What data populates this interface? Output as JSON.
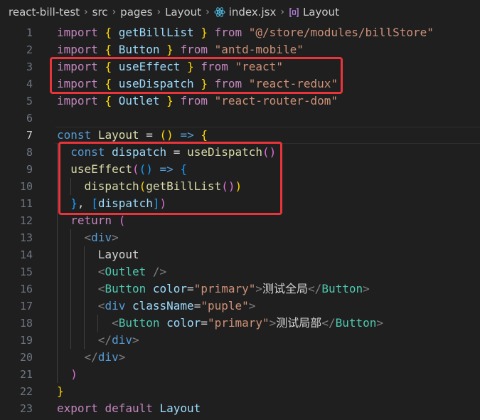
{
  "breadcrumb": {
    "project": "react-bill-test",
    "folder1": "src",
    "folder2": "pages",
    "folder3": "Layout",
    "file": "index.jsx",
    "symbol": "Layout",
    "file_icon": "react-icon",
    "symbol_icon": "symbol-method-icon"
  },
  "colors": {
    "background": "#1f1f1f",
    "keyword": "#569cd6",
    "control_keyword": "#c586c0",
    "function": "#dcdcaa",
    "variable": "#9cdcfe",
    "string": "#ce9178",
    "component": "#4ec9b0",
    "highlight_box": "#e8343a"
  },
  "editor": {
    "active_line": 7,
    "highlighted_ranges": [
      "3-4",
      "8-11"
    ],
    "lines": [
      {
        "n": "1",
        "t": {
          "k1": "import",
          "b1": "{",
          "id": "getBillList",
          "b2": "}",
          "from": "from",
          "s": "\"@/store/modules/billStore\""
        }
      },
      {
        "n": "2",
        "t": {
          "k1": "import",
          "b1": "{",
          "id": "Button",
          "b2": "}",
          "from": "from",
          "s": "\"antd-mobile\""
        }
      },
      {
        "n": "3",
        "t": {
          "k1": "import",
          "b1": "{",
          "id": "useEffect",
          "b2": "}",
          "from": "from",
          "s": "\"react\""
        }
      },
      {
        "n": "4",
        "t": {
          "k1": "import",
          "b1": "{",
          "id": "useDispatch",
          "b2": "}",
          "from": "from",
          "s": "\"react-redux\""
        }
      },
      {
        "n": "5",
        "t": {
          "k1": "import",
          "b1": "{",
          "id": "Outlet",
          "b2": "}",
          "from": "from",
          "s": "\"react-router-dom\""
        }
      },
      {
        "n": "6"
      },
      {
        "n": "7",
        "t": {
          "k1": "const",
          "id": "Layout",
          "eq": "=",
          "p1": "(",
          "p2": ")",
          "arrow": "=>",
          "b1": "{"
        }
      },
      {
        "n": "8",
        "t": {
          "k1": "const",
          "id": "dispatch",
          "eq": "=",
          "fn": "useDispatch",
          "p1": "(",
          "p2": ")"
        }
      },
      {
        "n": "9",
        "t": {
          "fn": "useEffect",
          "p1": "(",
          "p2": "(",
          "p3": ")",
          "arrow": "=>",
          "b1": "{"
        }
      },
      {
        "n": "10",
        "t": {
          "fn": "dispatch",
          "p1": "(",
          "fn2": "getBillList",
          "p2": "(",
          "p3": ")",
          "p4": ")"
        }
      },
      {
        "n": "11",
        "t": {
          "b1": "}",
          "comma": ",",
          "sq1": "[",
          "id": "dispatch",
          "sq2": "]",
          "p1": ")"
        }
      },
      {
        "n": "12",
        "t": {
          "kw": "return",
          "p1": "("
        }
      },
      {
        "n": "13",
        "t": {
          "lt": "<",
          "tag": "div",
          "gt": ">"
        }
      },
      {
        "n": "14",
        "t": {
          "text": "Layout"
        }
      },
      {
        "n": "15",
        "t": {
          "lt": "<",
          "tag": "Outlet",
          "end": " />"
        }
      },
      {
        "n": "16",
        "t": {
          "lt": "<",
          "tag": "Button",
          "attr": "color",
          "eq": "=",
          "val": "\"primary\"",
          "gt": ">",
          "text": "测试全局",
          "close_lt": "</",
          "close_tag": "Button",
          "close_gt": ">"
        }
      },
      {
        "n": "17",
        "t": {
          "lt": "<",
          "tag": "div",
          "attr": "className",
          "eq": "=",
          "val": "\"puple\"",
          "gt": ">"
        }
      },
      {
        "n": "18",
        "t": {
          "lt": "<",
          "tag": "Button",
          "attr": "color",
          "eq": "=",
          "val": "\"primary\"",
          "gt": ">",
          "text": "测试局部",
          "close_lt": "</",
          "close_tag": "Button",
          "close_gt": ">"
        }
      },
      {
        "n": "19",
        "t": {
          "lt": "</",
          "tag": "div",
          "gt": ">"
        }
      },
      {
        "n": "20",
        "t": {
          "lt": "</",
          "tag": "div",
          "gt": ">"
        }
      },
      {
        "n": "21",
        "t": {
          "p1": ")"
        }
      },
      {
        "n": "22",
        "t": {
          "b1": "}"
        }
      },
      {
        "n": "23",
        "t": {
          "k1": "export",
          "k2": "default",
          "id": "Layout"
        }
      }
    ]
  }
}
